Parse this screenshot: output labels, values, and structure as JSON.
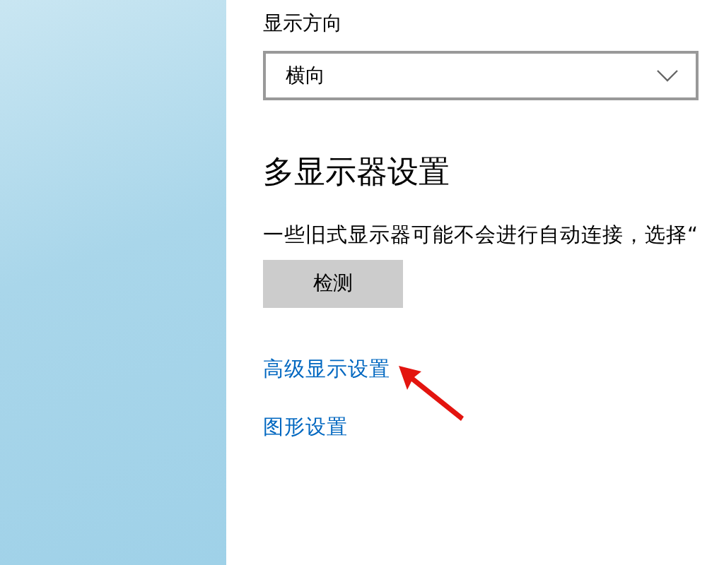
{
  "orientation": {
    "label": "显示方向",
    "value": "横向"
  },
  "multi_display": {
    "heading": "多显示器设置",
    "description": "一些旧式显示器可能不会进行自动连接，选择“",
    "button": "检测"
  },
  "links": [
    {
      "label": "高级显示设置",
      "annotated": true
    },
    {
      "label": "图形设置",
      "annotated": false
    }
  ]
}
